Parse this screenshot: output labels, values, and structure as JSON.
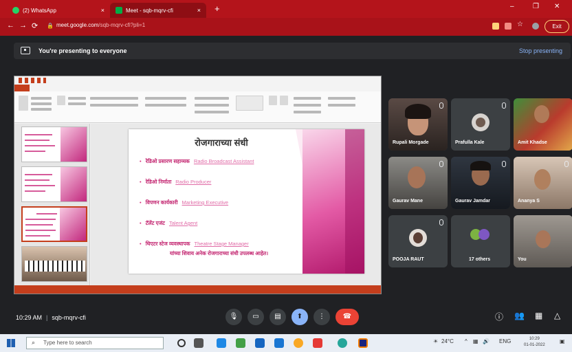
{
  "browser": {
    "tabs": [
      {
        "label": "(2) WhatsApp",
        "favicon_color": "#25d366"
      },
      {
        "label": "Meet - sqb-mqrv-cfi",
        "favicon_color": "#00ac47"
      }
    ],
    "url_host": "meet.google.com",
    "url_path": "/sqb-mqrv-cfi?pli=1",
    "exit_label": "Exit"
  },
  "banner": {
    "text": "You're presenting to everyone",
    "stop_label": "Stop presenting"
  },
  "presentation": {
    "slide_title": "रोजगाराच्या संधी",
    "bullets": [
      {
        "marathi": "रेडिओ प्रसारण सहाय्यक",
        "english": "Radio Broadcast Assistant"
      },
      {
        "marathi": "रेडिओ निर्माता",
        "english": "Radio Producer"
      },
      {
        "marathi": "विपणन कार्यकारी",
        "english": "Marketing Executive"
      },
      {
        "marathi": "टॅलेंट एजंट",
        "english": "Talent Agent"
      },
      {
        "marathi": "थिएटर स्टेज व्यवस्थापक",
        "english": "Theatre Stage Manager"
      }
    ],
    "closing_line": "यांच्या शिवाय अनेक रोजगाराच्या संधी उपलब्ध आहेत।"
  },
  "participants": [
    {
      "name": "Rupali Morgade"
    },
    {
      "name": "Prafulla Kale"
    },
    {
      "name": "Amit Khadse"
    },
    {
      "name": "Gaurav Mane"
    },
    {
      "name": "Gaurav Jamdar"
    },
    {
      "name": "Ananya S"
    },
    {
      "name": "POOJA RAUT"
    },
    {
      "name": "17 others"
    },
    {
      "name": "You"
    }
  ],
  "meeting": {
    "time": "10:29 AM",
    "code": "sqb-mqrv-cfi"
  },
  "taskbar": {
    "search_placeholder": "Type here to search",
    "weather": "24°C",
    "lang": "ENG",
    "clock_time": "10:29",
    "clock_date": "01-01-2022"
  }
}
